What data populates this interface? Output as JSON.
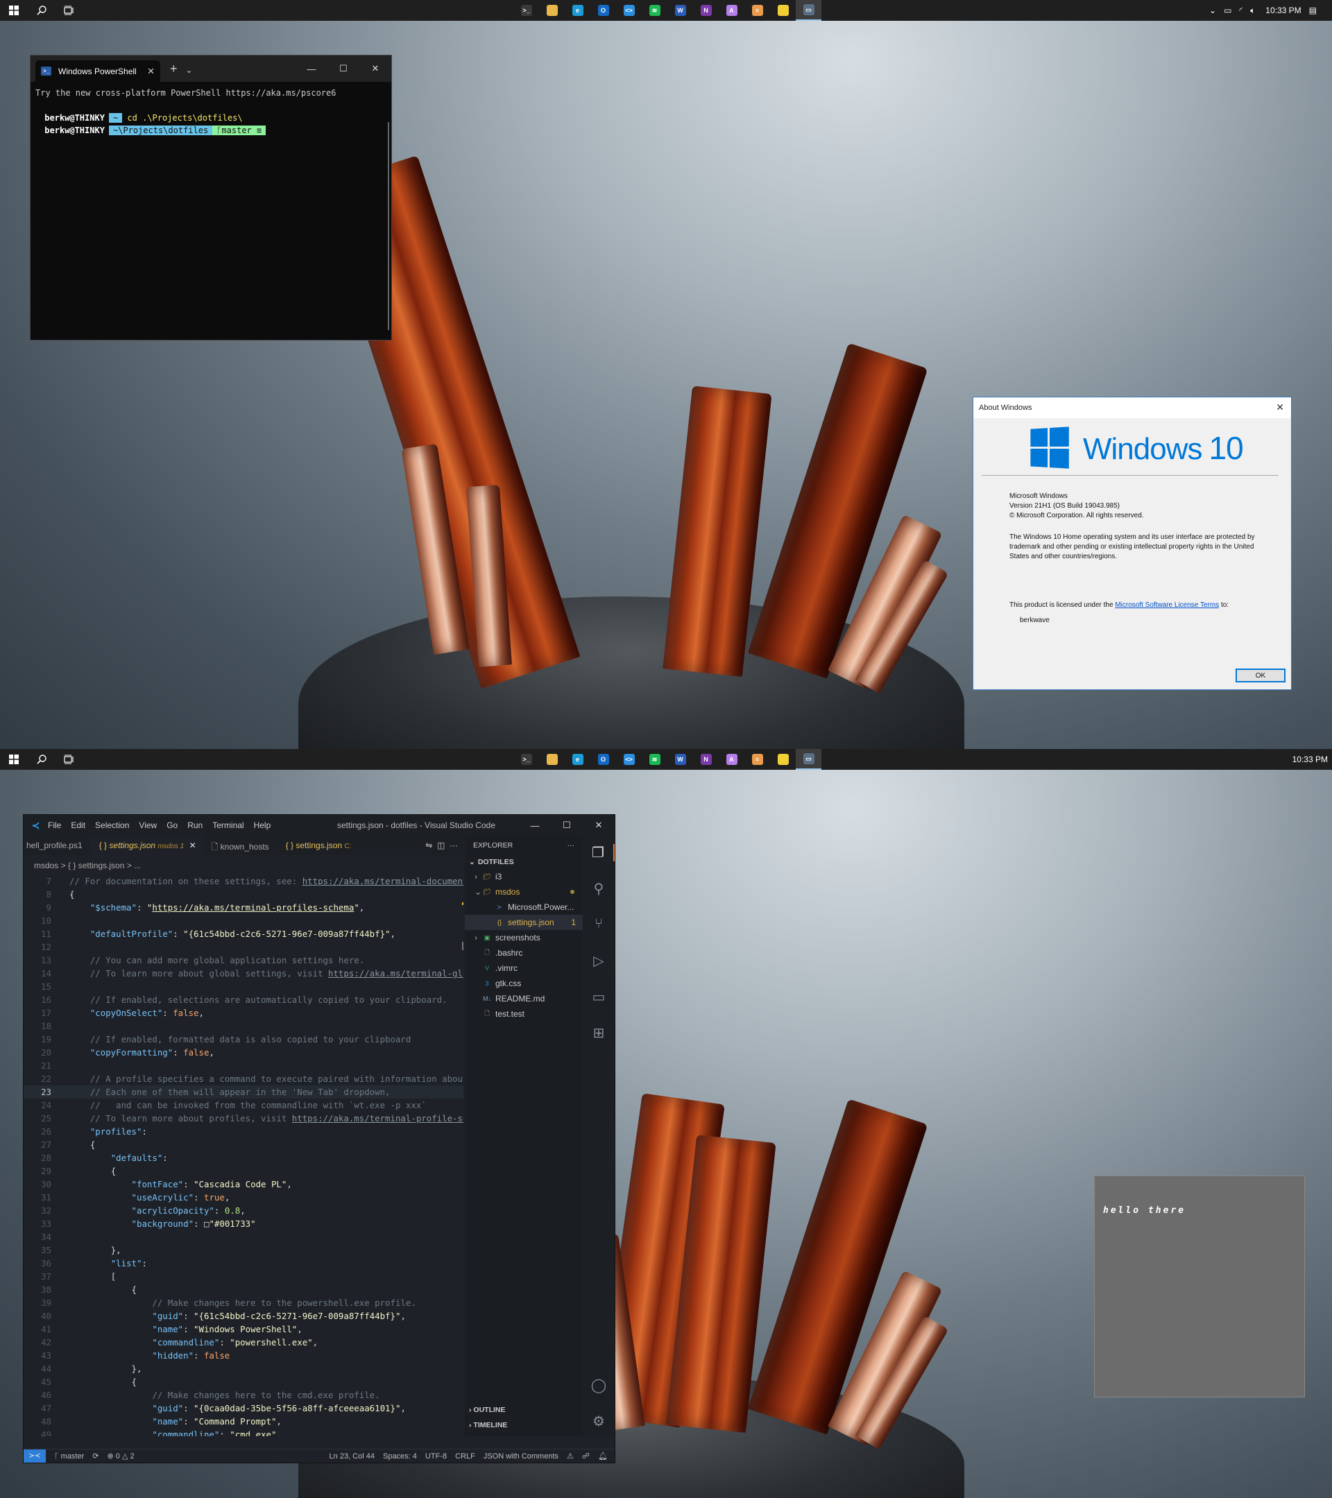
{
  "taskbar": {
    "clock": "10:33 PM",
    "apps": [
      {
        "name": "terminal-icon",
        "color": "#3a3a3a",
        "label": ">_"
      },
      {
        "name": "file-explorer-icon",
        "color": "#e8b84b",
        "label": ""
      },
      {
        "name": "edge-icon",
        "color": "#1d9bd7",
        "label": "e"
      },
      {
        "name": "outlook-icon",
        "color": "#1469c4",
        "label": "O"
      },
      {
        "name": "vscode-icon",
        "color": "#2b8fe0",
        "label": "<>"
      },
      {
        "name": "spotify-icon",
        "color": "#1db954",
        "label": "≋"
      },
      {
        "name": "word-icon",
        "color": "#2b5cb8",
        "label": "W"
      },
      {
        "name": "onenote-icon",
        "color": "#7b3aa8",
        "label": "N"
      },
      {
        "name": "affinity-icon",
        "color": "#b57ee8",
        "label": "A"
      },
      {
        "name": "paint-icon",
        "color": "#e99c4b",
        "label": "≡"
      },
      {
        "name": "sticky-notes-icon",
        "color": "#f2cf34",
        "label": ""
      },
      {
        "name": "about-windows-icon",
        "color": "#5a6f86",
        "label": "▭"
      }
    ]
  },
  "terminal": {
    "tab_title": "Windows PowerShell",
    "intro": "Try the new cross-platform PowerShell https://aka.ms/pscore6",
    "user": "berkw@THINKY",
    "home": "~",
    "command": "cd .\\Projects\\dotfiles\\",
    "path": "~\\Projects\\dotfiles",
    "git": "master ≡"
  },
  "about": {
    "title": "About Windows",
    "logo_text": "Windows",
    "logo_version": "10",
    "product": "Microsoft Windows",
    "version": "Version 21H1 (OS Build 19043.985)",
    "copyright": "© Microsoft Corporation. All rights reserved.",
    "description": "The Windows 10 Home operating system and its user interface are protected by trademark and other pending or existing intellectual property rights in the United States and other countries/regions.",
    "license_prefix": "This product is licensed under the",
    "license_link": "Microsoft Software License Terms",
    "license_suffix": "to:",
    "licensee": "berkwave",
    "ok": "OK"
  },
  "vscode": {
    "menu": [
      "File",
      "Edit",
      "Selection",
      "View",
      "Go",
      "Run",
      "Terminal",
      "Help"
    ],
    "window_title": "settings.json - dotfiles - Visual Studio Code",
    "tabs": [
      {
        "label": "hell_profile.ps1",
        "extra": ""
      },
      {
        "label": "settings.json",
        "extra": "msdos 1"
      },
      {
        "label": "known_hosts",
        "extra": ""
      },
      {
        "label": "settings.json",
        "extra": "C:"
      }
    ],
    "breadcrumb": "msdos  >  { }  settings.json  >  ...",
    "code_lines": [
      {
        "n": "7",
        "html": "<span class='cm'>// For documentation on these settings, see: <span class='ur'>https://aka.ms/terminal-documentation</span></span>"
      },
      {
        "n": "8",
        "html": "<span class='pu'>{</span>"
      },
      {
        "n": "9",
        "html": "    <span class='ky'>\"$schema\"</span><span class='pu'>: </span><span class='st'>\"<u>https://aka.ms/terminal-profiles-schema</u>\"</span><span class='pu'>,</span>"
      },
      {
        "n": "10",
        "html": ""
      },
      {
        "n": "11",
        "html": "    <span class='ky'>\"defaultProfile\"</span><span class='pu'>: </span><span class='st'>\"{61c54bbd-c2c6-5271-96e7-009a87ff44bf}\"</span><span class='pu'>,</span>"
      },
      {
        "n": "12",
        "html": ""
      },
      {
        "n": "13",
        "html": "    <span class='cm'>// You can add more global application settings here.</span>"
      },
      {
        "n": "14",
        "html": "    <span class='cm'>// To learn more about global settings, visit <span class='ur'>https://aka.ms/terminal-global-settings</span></span>"
      },
      {
        "n": "15",
        "html": ""
      },
      {
        "n": "16",
        "html": "    <span class='cm'>// If enabled, selections are automatically copied to your clipboard.</span>"
      },
      {
        "n": "17",
        "html": "    <span class='ky'>\"copyOnSelect\"</span><span class='pu'>: </span><span class='kw'>false</span><span class='pu'>,</span>"
      },
      {
        "n": "18",
        "html": ""
      },
      {
        "n": "19",
        "html": "    <span class='cm'>// If enabled, formatted data is also copied to your clipboard</span>"
      },
      {
        "n": "20",
        "html": "    <span class='ky'>\"copyFormatting\"</span><span class='pu'>: </span><span class='kw'>false</span><span class='pu'>,</span>"
      },
      {
        "n": "21",
        "html": ""
      },
      {
        "n": "22",
        "html": "    <span class='cm'>// A profile specifies a command to execute paired with information about how it should look and feel.</span>"
      },
      {
        "n": "23",
        "html": "    <span class='cm'>// Each one of them will appear in the 'New Tab' dropdown,</span>",
        "cur": true
      },
      {
        "n": "24",
        "html": "    <span class='cm'>//   and can be invoked from the commandline with `wt.exe -p xxx`</span>"
      },
      {
        "n": "25",
        "html": "    <span class='cm'>// To learn more about profiles, visit <span class='ur'>https://aka.ms/terminal-profile-settings</span></span>"
      },
      {
        "n": "26",
        "html": "    <span class='ky'>\"profiles\"</span><span class='pu'>:</span>"
      },
      {
        "n": "27",
        "html": "    <span class='pu'>{</span>"
      },
      {
        "n": "28",
        "html": "        <span class='ky'>\"defaults\"</span><span class='pu'>:</span>"
      },
      {
        "n": "29",
        "html": "        <span class='pu'>{</span>"
      },
      {
        "n": "30",
        "html": "            <span class='ky'>\"fontFace\"</span><span class='pu'>: </span><span class='st'>\"Cascadia Code PL\"</span><span class='pu'>,</span>"
      },
      {
        "n": "31",
        "html": "            <span class='ky'>\"useAcrylic\"</span><span class='pu'>: </span><span class='kw'>true</span><span class='pu'>,</span>"
      },
      {
        "n": "32",
        "html": "            <span class='ky'>\"acrylicOpacity\"</span><span class='pu'>: </span><span class='nm'>0.8</span><span class='pu'>,</span>"
      },
      {
        "n": "33",
        "html": "            <span class='ky'>\"background\"</span><span class='pu'>: </span><span class='pu'>□</span><span class='st'>\"#001733\"</span>"
      },
      {
        "n": "34",
        "html": ""
      },
      {
        "n": "35",
        "html": "        <span class='pu'>},</span>"
      },
      {
        "n": "36",
        "html": "        <span class='ky'>\"list\"</span><span class='pu'>:</span>"
      },
      {
        "n": "37",
        "html": "        <span class='pu'>[</span>"
      },
      {
        "n": "38",
        "html": "            <span class='pu'>{</span>"
      },
      {
        "n": "39",
        "html": "                <span class='cm'>// Make changes here to the powershell.exe profile.</span>"
      },
      {
        "n": "40",
        "html": "                <span class='ky'>\"guid\"</span><span class='pu'>: </span><span class='st'>\"{61c54bbd-c2c6-5271-96e7-009a87ff44bf}\"</span><span class='pu'>,</span>"
      },
      {
        "n": "41",
        "html": "                <span class='ky'>\"name\"</span><span class='pu'>: </span><span class='st'>\"Windows PowerShell\"</span><span class='pu'>,</span>"
      },
      {
        "n": "42",
        "html": "                <span class='ky'>\"commandline\"</span><span class='pu'>: </span><span class='st'>\"powershell.exe\"</span><span class='pu'>,</span>"
      },
      {
        "n": "43",
        "html": "                <span class='ky'>\"hidden\"</span><span class='pu'>: </span><span class='kw'>false</span>"
      },
      {
        "n": "44",
        "html": "            <span class='pu'>},</span>"
      },
      {
        "n": "45",
        "html": "            <span class='pu'>{</span>"
      },
      {
        "n": "46",
        "html": "                <span class='cm'>// Make changes here to the cmd.exe profile.</span>"
      },
      {
        "n": "47",
        "html": "                <span class='ky'>\"guid\"</span><span class='pu'>: </span><span class='st'>\"{0caa0dad-35be-5f56-a8ff-afceeeaa6101}\"</span><span class='pu'>,</span>"
      },
      {
        "n": "48",
        "html": "                <span class='ky'>\"name\"</span><span class='pu'>: </span><span class='st'>\"Command Prompt\"</span><span class='pu'>,</span>"
      },
      {
        "n": "49",
        "html": "                <span class='ky'>\"commandline\"</span><span class='pu'>: </span><span class='st'>\"cmd.exe\"</span><span class='pu'>,</span>"
      }
    ],
    "explorer": {
      "header": "EXPLORER",
      "section": "DOTFILES",
      "items": [
        {
          "label": "i3",
          "icon": "folder",
          "level": 0,
          "arrow": "›",
          "sel": false
        },
        {
          "label": "msdos",
          "icon": "folder",
          "level": 0,
          "arrow": "⌄",
          "sel": false,
          "color": "#e0b24c"
        },
        {
          "label": "Microsoft.Power...",
          "icon": "ps",
          "level": 1,
          "arrow": "",
          "sel": false
        },
        {
          "label": "settings.json",
          "icon": "json",
          "level": 1,
          "arrow": "",
          "sel": true,
          "color": "#e0b24c",
          "badge": "1"
        },
        {
          "label": "screenshots",
          "icon": "folder-img",
          "level": 0,
          "arrow": "›",
          "sel": false
        },
        {
          "label": ".bashrc",
          "icon": "file",
          "level": 0,
          "arrow": "",
          "sel": false
        },
        {
          "label": ".vimrc",
          "icon": "vim",
          "level": 0,
          "arrow": "",
          "sel": false
        },
        {
          "label": "gtk.css",
          "icon": "css",
          "level": 0,
          "arrow": "",
          "sel": false
        },
        {
          "label": "README.md",
          "icon": "md",
          "level": 0,
          "arrow": "",
          "sel": false
        },
        {
          "label": "test.test",
          "icon": "file",
          "level": 0,
          "arrow": "",
          "sel": false
        }
      ],
      "outline": "OUTLINE",
      "timeline": "TIMELINE"
    },
    "status": {
      "branch": "master",
      "errors": "0",
      "warnings": "2",
      "position": "Ln 23, Col 44",
      "spaces": "Spaces: 4",
      "encoding": "UTF-8",
      "eol": "CRLF",
      "language": "JSON with Comments"
    }
  },
  "sticky": {
    "text": "hello there"
  }
}
